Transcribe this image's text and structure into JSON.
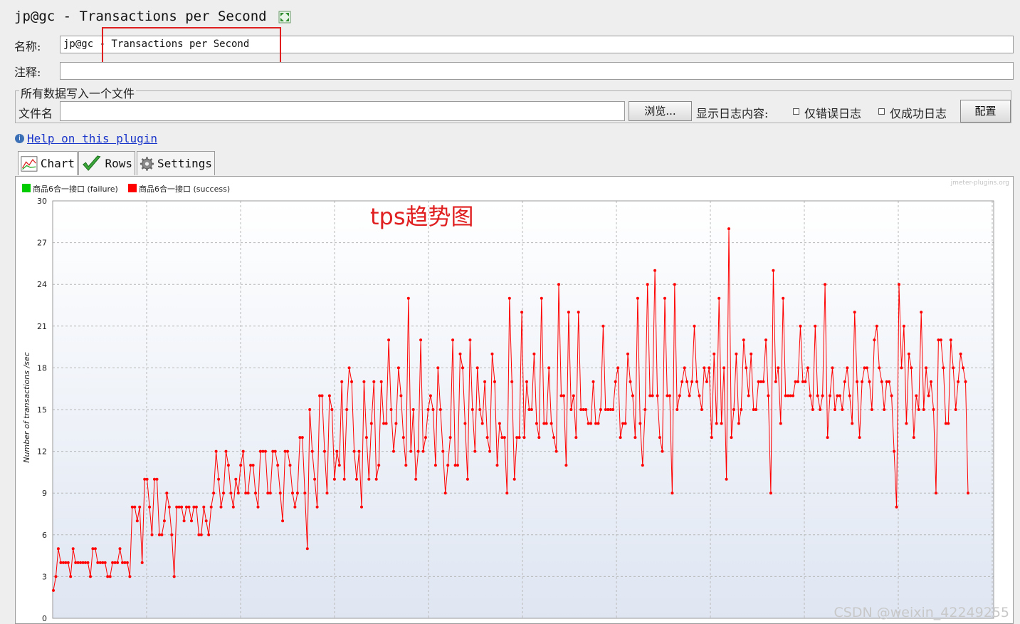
{
  "window": {
    "title": "jp@gc - Transactions per Second"
  },
  "form": {
    "name_label": "名称:",
    "name_value": "jp@gc - Transactions per Second",
    "comment_label": "注释:",
    "comment_value": ""
  },
  "file_section": {
    "group_title": "所有数据写入一个文件",
    "filename_label": "文件名",
    "filename_value": "",
    "browse_button": "浏览...",
    "log_content_label": "显示日志内容:",
    "errors_only_label": "仅错误日志",
    "errors_only_checked": false,
    "success_only_label": "仅成功日志",
    "success_only_checked": false,
    "configure_button": "配置"
  },
  "help": {
    "link_text": "Help on this plugin"
  },
  "tabs": [
    {
      "label": "Chart",
      "icon": "chart-icon"
    },
    {
      "label": "Rows",
      "icon": "checkmark-icon"
    },
    {
      "label": "Settings",
      "icon": "gear-icon"
    }
  ],
  "chart_header": {
    "watermark": "jmeter-plugins.org",
    "annotation": "tps趋势图",
    "corner_watermark": "CSDN @weixin_42249255"
  },
  "colors": {
    "success": "#ff0000",
    "failure": "#00cc00",
    "highlight": "#e02020",
    "annotation": "#e02020"
  },
  "chart_data": {
    "type": "line",
    "ylabel": "Number of transactions /sec",
    "xlabel": "",
    "ylim": [
      0,
      30
    ],
    "yticks": [
      0,
      3,
      6,
      9,
      12,
      15,
      18,
      21,
      24,
      27,
      30
    ],
    "grid": true,
    "legend_position": "top-left",
    "series": [
      {
        "name": "商品6合一接口 (failure)",
        "color": "#00cc00",
        "values": []
      },
      {
        "name": "商品6合一接口 (success)",
        "color": "#ff0000",
        "values": [
          2,
          3,
          5,
          4,
          4,
          4,
          4,
          3,
          5,
          4,
          4,
          4,
          4,
          4,
          4,
          3,
          5,
          5,
          4,
          4,
          4,
          4,
          3,
          3,
          4,
          4,
          4,
          5,
          4,
          4,
          4,
          3,
          8,
          8,
          7,
          8,
          4,
          10,
          10,
          8,
          6,
          10,
          10,
          6,
          6,
          7,
          9,
          8,
          6,
          3,
          8,
          8,
          8,
          7,
          8,
          8,
          7,
          8,
          8,
          6,
          6,
          8,
          7,
          6,
          8,
          9,
          12,
          10,
          8,
          9,
          12,
          11,
          9,
          8,
          10,
          9,
          11,
          12,
          9,
          9,
          11,
          11,
          9,
          8,
          12,
          12,
          12,
          9,
          9,
          12,
          12,
          11,
          9,
          7,
          12,
          12,
          11,
          9,
          8,
          9,
          13,
          13,
          9,
          5,
          15,
          12,
          10,
          8,
          16,
          16,
          12,
          9,
          16,
          15,
          10,
          12,
          11,
          17,
          10,
          15,
          18,
          17,
          12,
          10,
          12,
          8,
          17,
          13,
          10,
          14,
          17,
          10,
          11,
          17,
          14,
          14,
          20,
          15,
          12,
          14,
          18,
          16,
          13,
          11,
          23,
          12,
          15,
          10,
          12,
          20,
          12,
          13,
          15,
          16,
          15,
          11,
          18,
          15,
          12,
          9,
          11,
          13,
          20,
          11,
          11,
          19,
          18,
          14,
          10,
          20,
          15,
          12,
          18,
          15,
          14,
          17,
          13,
          12,
          19,
          17,
          11,
          14,
          13,
          13,
          9,
          23,
          17,
          10,
          13,
          13,
          22,
          13,
          17,
          15,
          15,
          19,
          14,
          13,
          23,
          14,
          14,
          18,
          14,
          13,
          12,
          24,
          16,
          16,
          11,
          22,
          15,
          16,
          13,
          22,
          15,
          15,
          15,
          14,
          14,
          17,
          14,
          14,
          15,
          21,
          15,
          15,
          15,
          15,
          17,
          18,
          13,
          14,
          14,
          19,
          17,
          16,
          13,
          23,
          14,
          11,
          15,
          24,
          16,
          16,
          25,
          16,
          13,
          12,
          23,
          16,
          16,
          9,
          24,
          15,
          16,
          17,
          18,
          17,
          16,
          17,
          21,
          17,
          16,
          15,
          18,
          17,
          18,
          13,
          19,
          14,
          23,
          14,
          18,
          10,
          28,
          13,
          15,
          19,
          14,
          15,
          20,
          18,
          16,
          19,
          15,
          15,
          17,
          17,
          17,
          20,
          16,
          9,
          25,
          17,
          18,
          14,
          23,
          16,
          16,
          16,
          16,
          17,
          17,
          21,
          17,
          17,
          18,
          16,
          15,
          21,
          16,
          15,
          16,
          24,
          13,
          16,
          18,
          15,
          16,
          16,
          15,
          17,
          18,
          16,
          14,
          22,
          17,
          13,
          17,
          18,
          18,
          17,
          15,
          20,
          21,
          18,
          17,
          15,
          17,
          17,
          16,
          12,
          8,
          24,
          18,
          21,
          14,
          19,
          18,
          13,
          16,
          15,
          22,
          15,
          18,
          16,
          17,
          15,
          9,
          20,
          20,
          18,
          14,
          14,
          20,
          18,
          15,
          17,
          19,
          18,
          17,
          9
        ],
        "x_index_note": ""
      }
    ]
  }
}
